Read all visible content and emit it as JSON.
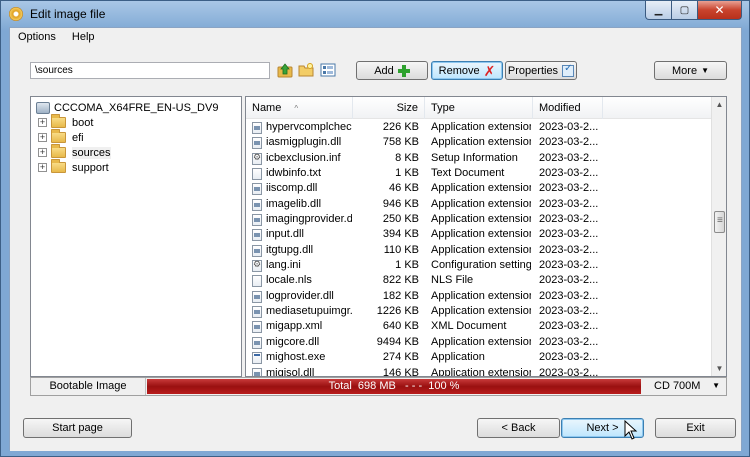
{
  "window": {
    "title": "Edit image file"
  },
  "menu": [
    "Options",
    "Help"
  ],
  "toolbar": {
    "path": "\\sources",
    "add_label": "Add",
    "remove_label": "Remove",
    "properties_label": "Properties",
    "more_label": "More"
  },
  "tree": {
    "root": "CCCOMA_X64FRE_EN-US_DV9",
    "folders": [
      "boot",
      "efi",
      "sources",
      "support"
    ],
    "selected": "sources"
  },
  "filelist": {
    "columns": [
      "Name",
      "Size",
      "Type",
      "Modified"
    ],
    "rows": [
      {
        "name": "hypervcomplchec...",
        "size": "226 KB",
        "type": "Application extension",
        "modified": "2023-03-2...",
        "icon": "dll"
      },
      {
        "name": "iasmigplugin.dll",
        "size": "758 KB",
        "type": "Application extension",
        "modified": "2023-03-2...",
        "icon": "dll"
      },
      {
        "name": "icbexclusion.inf",
        "size": "8 KB",
        "type": "Setup Information",
        "modified": "2023-03-2...",
        "icon": "inf"
      },
      {
        "name": "idwbinfo.txt",
        "size": "1 KB",
        "type": "Text Document",
        "modified": "2023-03-2...",
        "icon": "txt"
      },
      {
        "name": "iiscomp.dll",
        "size": "46 KB",
        "type": "Application extension",
        "modified": "2023-03-2...",
        "icon": "dll"
      },
      {
        "name": "imagelib.dll",
        "size": "946 KB",
        "type": "Application extension",
        "modified": "2023-03-2...",
        "icon": "dll"
      },
      {
        "name": "imagingprovider.dll",
        "size": "250 KB",
        "type": "Application extension",
        "modified": "2023-03-2...",
        "icon": "dll"
      },
      {
        "name": "input.dll",
        "size": "394 KB",
        "type": "Application extension",
        "modified": "2023-03-2...",
        "icon": "dll"
      },
      {
        "name": "itgtupg.dll",
        "size": "110 KB",
        "type": "Application extension",
        "modified": "2023-03-2...",
        "icon": "dll"
      },
      {
        "name": "lang.ini",
        "size": "1 KB",
        "type": "Configuration settings",
        "modified": "2023-03-2...",
        "icon": "inf"
      },
      {
        "name": "locale.nls",
        "size": "822 KB",
        "type": "NLS File",
        "modified": "2023-03-2...",
        "icon": "txt"
      },
      {
        "name": "logprovider.dll",
        "size": "182 KB",
        "type": "Application extension",
        "modified": "2023-03-2...",
        "icon": "dll"
      },
      {
        "name": "mediasetupuimgr.dll",
        "size": "1226 KB",
        "type": "Application extension",
        "modified": "2023-03-2...",
        "icon": "dll"
      },
      {
        "name": "migapp.xml",
        "size": "640 KB",
        "type": "XML Document",
        "modified": "2023-03-2...",
        "icon": "dll"
      },
      {
        "name": "migcore.dll",
        "size": "9494 KB",
        "type": "Application extension",
        "modified": "2023-03-2...",
        "icon": "dll"
      },
      {
        "name": "mighost.exe",
        "size": "274 KB",
        "type": "Application",
        "modified": "2023-03-2...",
        "icon": "exe"
      },
      {
        "name": "migisol.dll",
        "size": "146 KB",
        "type": "Application extension",
        "modified": "2023-03-2...",
        "icon": "dll"
      }
    ]
  },
  "status": {
    "label": "Bootable Image",
    "progress_text": "Total  698 MB   - - -  100 %",
    "progress_percent": 100,
    "media": "CD 700M"
  },
  "buttons": {
    "start_page": "Start page",
    "back": "< Back",
    "next": "Next >",
    "exit": "Exit"
  },
  "colors": {
    "progress": "#b81c1c",
    "accent": "#3c7fb1"
  }
}
